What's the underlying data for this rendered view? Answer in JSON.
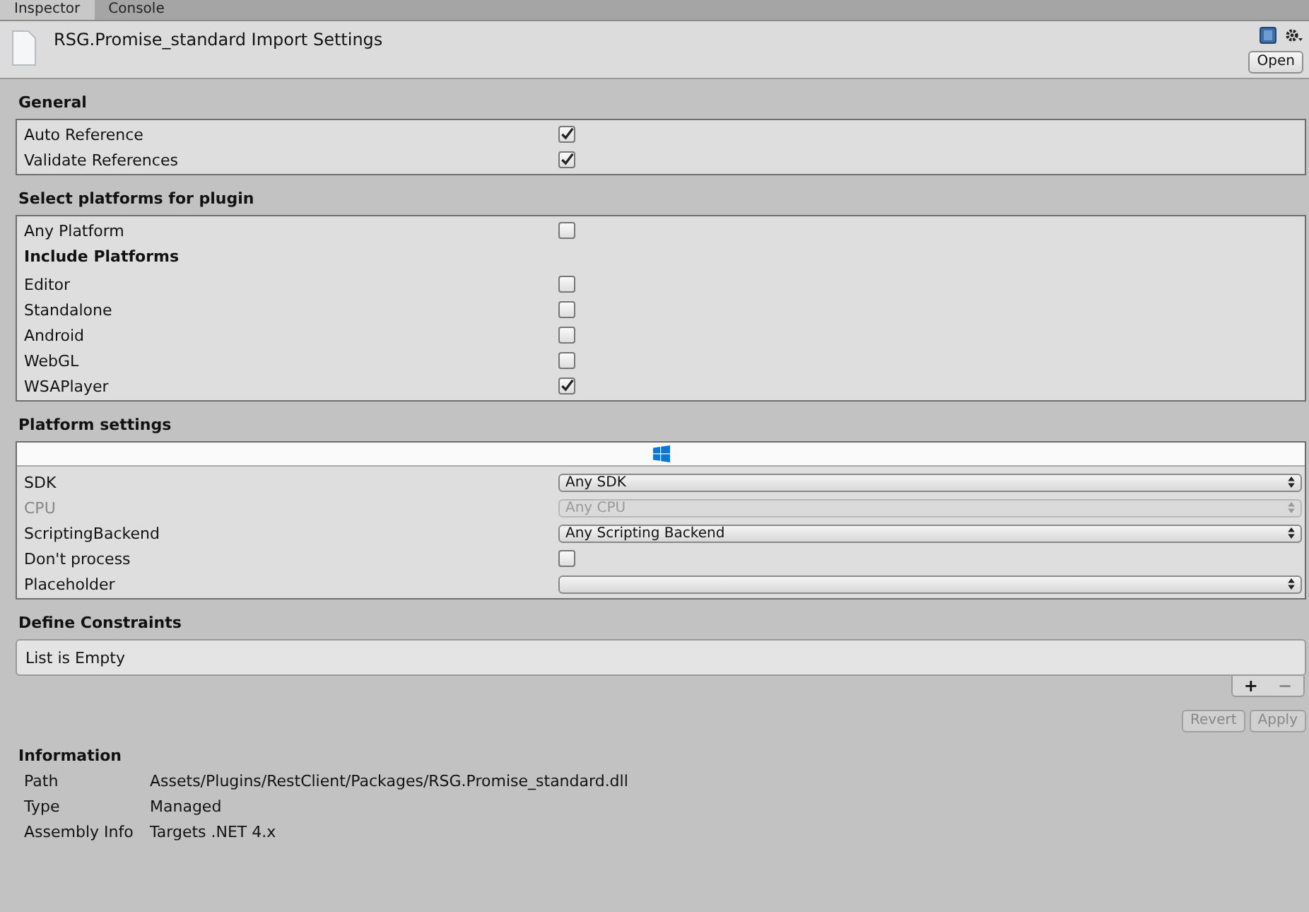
{
  "tabs": [
    {
      "label": "Inspector",
      "selected": true
    },
    {
      "label": "Console",
      "selected": false
    }
  ],
  "header": {
    "title": "RSG.Promise_standard Import Settings",
    "open_button": "Open"
  },
  "general": {
    "title": "General",
    "rows": [
      {
        "label": "Auto Reference",
        "checked": true
      },
      {
        "label": "Validate References",
        "checked": true
      }
    ]
  },
  "platforms": {
    "title": "Select platforms for plugin",
    "any": {
      "label": "Any Platform",
      "checked": false
    },
    "include_title": "Include Platforms",
    "rows": [
      {
        "label": "Editor",
        "checked": false
      },
      {
        "label": "Standalone",
        "checked": false
      },
      {
        "label": "Android",
        "checked": false
      },
      {
        "label": "WebGL",
        "checked": false
      },
      {
        "label": "WSAPlayer",
        "checked": true
      }
    ]
  },
  "platform_settings": {
    "title": "Platform settings",
    "rows": [
      {
        "kind": "dropdown",
        "label": "SDK",
        "value": "Any SDK",
        "disabled": false
      },
      {
        "kind": "dropdown",
        "label": "CPU",
        "value": "Any CPU",
        "disabled": true
      },
      {
        "kind": "dropdown",
        "label": "ScriptingBackend",
        "value": "Any Scripting Backend",
        "disabled": false
      },
      {
        "kind": "checkbox",
        "label": "Don't process",
        "checked": false
      },
      {
        "kind": "dropdown",
        "label": "Placeholder",
        "disabled": false
      }
    ]
  },
  "define_constraints": {
    "title": "Define Constraints",
    "empty_text": "List is Empty",
    "add": "+",
    "remove": "−"
  },
  "buttons": [
    {
      "label": "Revert",
      "disabled": true
    },
    {
      "label": "Apply",
      "disabled": true
    }
  ],
  "information": {
    "title": "Information",
    "rows": [
      {
        "label": "Path",
        "value": "Assets/Plugins/RestClient/Packages/RSG.Promise_standard.dll"
      },
      {
        "label": "Type",
        "value": "Managed"
      },
      {
        "label": "Assembly Info",
        "value": "Targets .NET 4.x"
      }
    ]
  }
}
